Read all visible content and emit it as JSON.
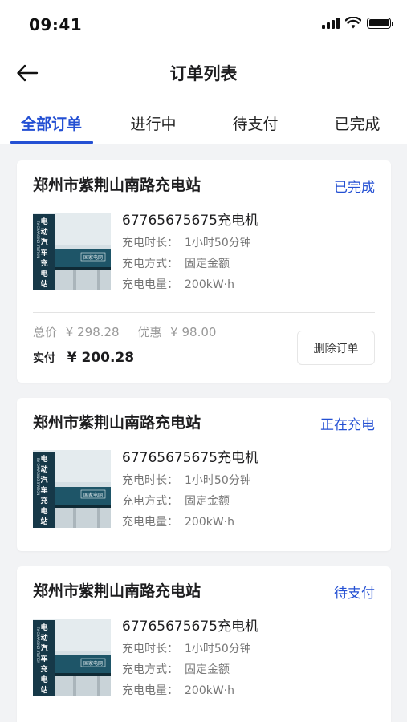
{
  "status_bar": {
    "time": "09:41"
  },
  "header": {
    "title": "订单列表"
  },
  "tabs": [
    {
      "label": "全部订单",
      "active": true
    },
    {
      "label": "进行中",
      "active": false
    },
    {
      "label": "待支付",
      "active": false
    },
    {
      "label": "已完成",
      "active": false
    }
  ],
  "orders": [
    {
      "station": "郑州市紫荆山南路充电站",
      "status": "已完成",
      "device": "67765675675充电机",
      "duration_label": "充电时长：",
      "duration": "1小时50分钟",
      "mode_label": "充电方式：",
      "mode": "固定金额",
      "energy_label": "充电电量：",
      "energy": "200kW·h",
      "total_label": "总价",
      "total": "¥ 298.28",
      "discount_label": "优惠",
      "discount": "¥ 98.00",
      "paid_label": "实付",
      "paid": "¥ 200.28",
      "delete_label": "删除订单"
    },
    {
      "station": "郑州市紫荆山南路充电站",
      "status": "正在充电",
      "device": "67765675675充电机",
      "duration_label": "充电时长：",
      "duration": "1小时50分钟",
      "mode_label": "充电方式：",
      "mode": "固定金额",
      "energy_label": "充电电量：",
      "energy": "200kW·h"
    },
    {
      "station": "郑州市紫荆山南路充电站",
      "status": "待支付",
      "device": "67765675675充电机",
      "duration_label": "充电时长：",
      "duration": "1小时50分钟",
      "mode_label": "充电方式：",
      "mode": "固定金额",
      "energy_label": "充电电量：",
      "energy": "200kW·h"
    }
  ],
  "thumbnail": {
    "vertical_sign": "电动汽车充电站",
    "vertical_sign_en": "EV CHARGING STATION",
    "canopy_text": "国家电网"
  },
  "colors": {
    "accent": "#2450d3",
    "background": "#f2f3f5",
    "card": "#ffffff"
  }
}
